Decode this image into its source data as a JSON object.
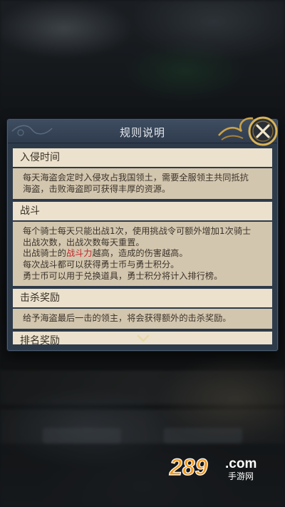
{
  "dialog": {
    "title": "规则说明",
    "sections": [
      {
        "heading": "入侵时间",
        "lines": [
          "每天海盗会定时入侵攻占我国领土，需要全服领主共同抵抗",
          "海盗，击败海盗即可获得丰厚的资源。"
        ]
      },
      {
        "heading": "战斗",
        "lines": [
          "每个骑士每天只能出战1次，使用挑战令可额外增加1次骑士",
          "出战次数，出战次数每天重置。"
        ],
        "highlight_line": {
          "before": "出战骑士的",
          "highlight": "战斗力",
          "after": "越高，造成的伤害越高。"
        },
        "more_lines": [
          "每次战斗都可以获得勇士币与勇士积分。",
          "勇士币可以用于兑换道具，勇士积分将计入排行榜。"
        ]
      },
      {
        "heading": "击杀奖励",
        "lines": [
          "给予海盗最后一击的领主，将会获得额外的击杀奖励。"
        ]
      },
      {
        "heading": "排名奖励"
      }
    ]
  },
  "watermark": {
    "number": "289",
    "suffix": ".com",
    "tagline": "手游网"
  },
  "colors": {
    "highlight": "#c3272d",
    "panel_frame": "#2d3a4a",
    "section_header": "#ebe1cc",
    "section_body": "#d3c6ae",
    "logo_orange": "#f39a1e"
  }
}
